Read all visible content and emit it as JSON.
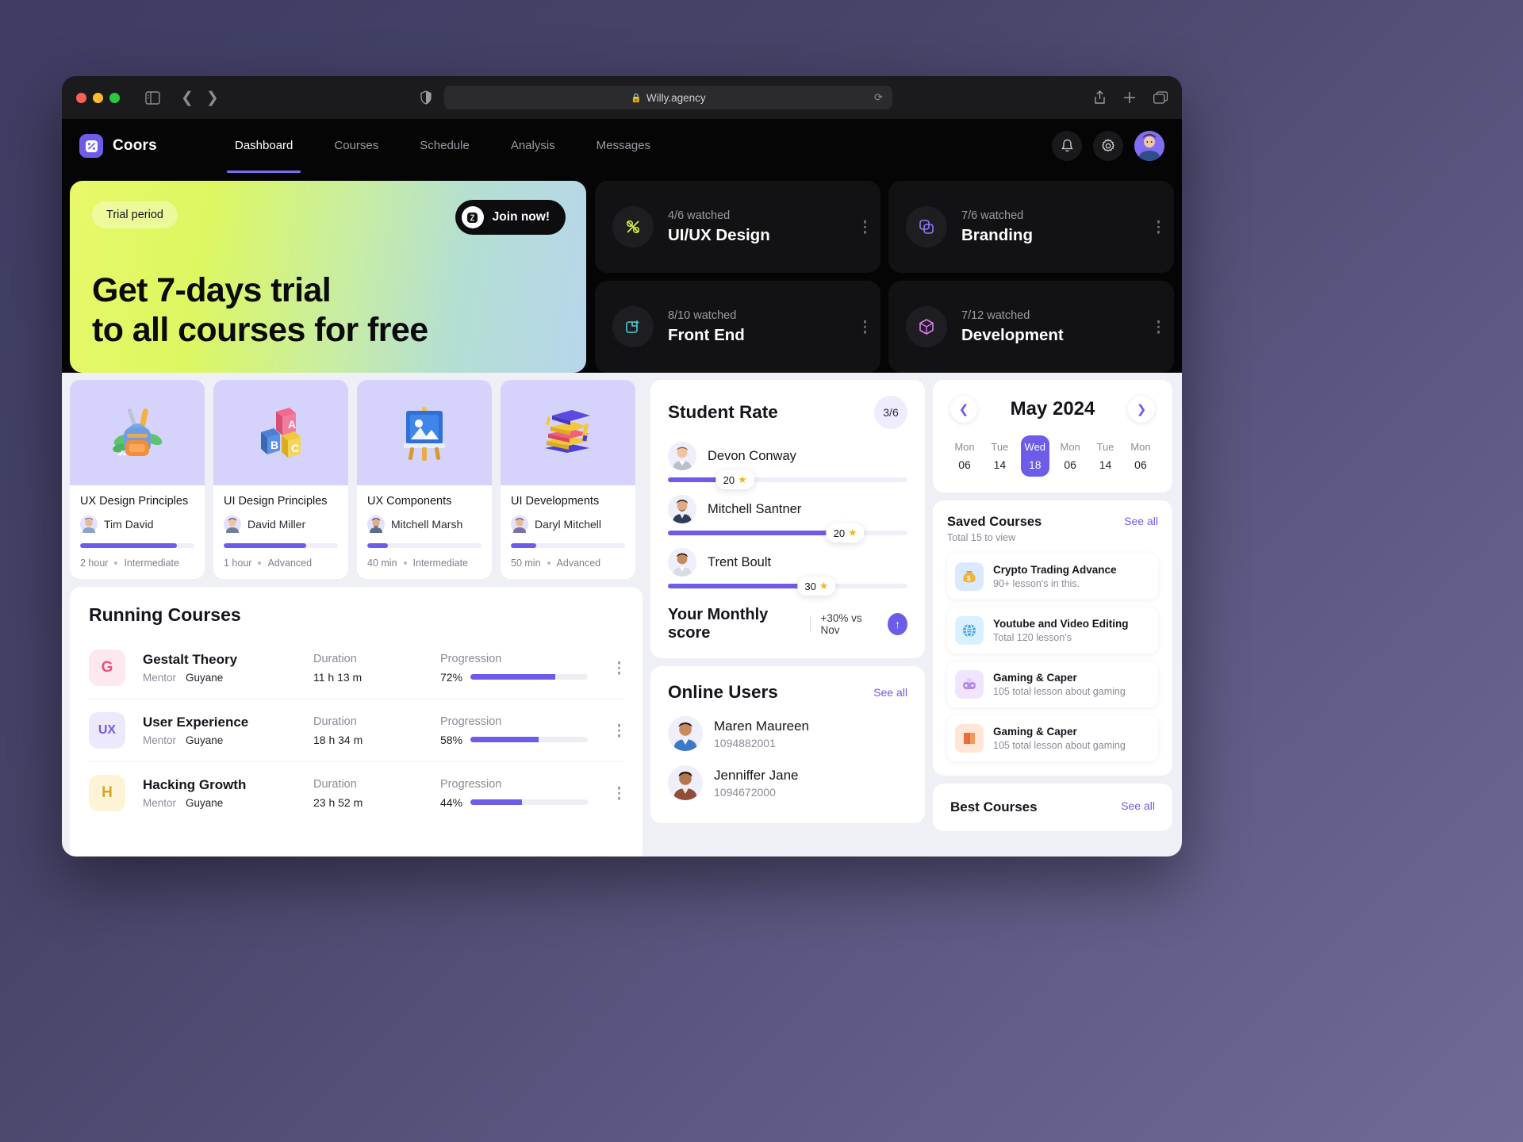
{
  "browser": {
    "url": "Willy.agency",
    "lock_icon": "lock-icon",
    "reload_icon": "reload-icon",
    "sidebar_icon": "sidebar-toggle-icon",
    "back_icon": "back-arrow-icon",
    "forward_icon": "forward-arrow-icon",
    "shield_icon": "shield-icon",
    "share_icon": "share-icon",
    "new_tab_icon": "plus-icon",
    "tabs_icon": "tabs-overview-icon"
  },
  "nav": {
    "brand": "Coors",
    "logo_icon": "coors-logo-icon",
    "tabs": [
      {
        "label": "Dashboard",
        "active": true
      },
      {
        "label": "Courses",
        "active": false
      },
      {
        "label": "Schedule",
        "active": false
      },
      {
        "label": "Analysis",
        "active": false
      },
      {
        "label": "Messages",
        "active": false
      }
    ],
    "bell_icon": "bell-icon",
    "gear_icon": "gear-icon",
    "avatar": "user-avatar"
  },
  "hero": {
    "pill": "Trial period",
    "cta": "Join now!",
    "cta_icon": "ticket-icon",
    "title_line1": "Get 7-days trial",
    "title_line2": "to all courses for free"
  },
  "stats": [
    {
      "watched": "4/6 watched",
      "title": "UI/UX Design",
      "icon": "sparkle-cross-icon",
      "color": "#d8f24b"
    },
    {
      "watched": "7/6 watched",
      "title": "Branding",
      "icon": "copy-layers-icon",
      "color": "#8e7bf5"
    },
    {
      "watched": "8/10 watched",
      "title": "Front End",
      "icon": "code-window-icon",
      "color": "#4bc8d8"
    },
    {
      "watched": "7/12 watched",
      "title": "Development",
      "icon": "cube-icon",
      "color": "#e07bf5"
    }
  ],
  "course_cards": [
    {
      "title": "UX Design Principles",
      "mentor": "Tim David",
      "avatar": "mentor-avatar",
      "progress": 85,
      "duration": "2 hour",
      "level": "Intermediate",
      "thumb": "backpack-illustration"
    },
    {
      "title": "UI Design Principles",
      "mentor": "David Miller",
      "avatar": "mentor-avatar",
      "progress": 72,
      "duration": "1 hour",
      "level": "Advanced",
      "thumb": "abc-blocks-illustration"
    },
    {
      "title": "UX Components",
      "mentor": "Mitchell Marsh",
      "avatar": "mentor-avatar",
      "progress": 18,
      "duration": "40 min",
      "level": "Intermediate",
      "thumb": "easel-illustration"
    },
    {
      "title": "UI Developments",
      "mentor": "Daryl Mitchell",
      "avatar": "mentor-avatar",
      "progress": 22,
      "duration": "50 min",
      "level": "Advanced",
      "thumb": "graduation-books-illustration"
    }
  ],
  "running": {
    "title": "Running Courses",
    "headers": {
      "duration": "Duration",
      "progression": "Progression",
      "mentor": "Mentor"
    },
    "rows": [
      {
        "initial": "G",
        "name": "Gestalt Theory",
        "mentor_label": "Mentor",
        "mentor": "Guyane",
        "duration": "11 h 13 m",
        "progress_label": "72%",
        "progress": 72,
        "bg": "#fce8ef",
        "fg": "#e8547f"
      },
      {
        "initial": "UX",
        "name": "User Experience",
        "mentor_label": "Mentor",
        "mentor": "Guyane",
        "duration": "18 h 34 m",
        "progress_label": "58%",
        "progress": 58,
        "bg": "#ece9fd",
        "fg": "#6c5ce7"
      },
      {
        "initial": "H",
        "name": "Hacking Growth",
        "mentor_label": "Mentor",
        "mentor": "Guyane",
        "duration": "23 h 52 m",
        "progress_label": "44%",
        "progress": 44,
        "bg": "#fdf3d6",
        "fg": "#d8a521"
      }
    ]
  },
  "student_rate": {
    "title": "Student Rate",
    "badge": "3/6",
    "students": [
      {
        "name": "Devon Conway",
        "score": "20",
        "fill": 22,
        "avatar": "student-avatar"
      },
      {
        "name": "Mitchell Santner",
        "score": "20",
        "fill": 68,
        "avatar": "student-avatar"
      },
      {
        "name": "Trent Boult",
        "score": "30",
        "fill": 56,
        "avatar": "student-avatar"
      }
    ],
    "monthly_label": "Your Monthly score",
    "monthly_delta": "+30% vs Nov",
    "monthly_icon": "arrow-up-icon"
  },
  "online_users": {
    "title": "Online Users",
    "see_all": "See all",
    "users": [
      {
        "name": "Maren Maureen",
        "id": "1094882001",
        "avatar": "user-avatar"
      },
      {
        "name": "Jenniffer Jane",
        "id": "1094672000",
        "avatar": "user-avatar"
      }
    ]
  },
  "calendar": {
    "month": "May 2024",
    "prev_icon": "chevron-left-icon",
    "next_icon": "chevron-right-icon",
    "days": [
      {
        "name": "Mon",
        "num": "06",
        "selected": false
      },
      {
        "name": "Tue",
        "num": "14",
        "selected": false
      },
      {
        "name": "Wed",
        "num": "18",
        "selected": true
      },
      {
        "name": "Mon",
        "num": "06",
        "selected": false
      },
      {
        "name": "Tue",
        "num": "14",
        "selected": false
      },
      {
        "name": "Mon",
        "num": "06",
        "selected": false
      }
    ]
  },
  "saved_courses": {
    "title": "Saved Courses",
    "subtitle": "Total 15 to view",
    "see_all": "See all",
    "items": [
      {
        "title": "Crypto Trading Advance",
        "sub": "90+ lesson's in this.",
        "icon": "money-bag-icon",
        "bg": "#dbe9ff"
      },
      {
        "title": "Youtube and Video Editing",
        "sub": "Total 120 lesson's",
        "icon": "globe-icon",
        "bg": "#d8f0ff"
      },
      {
        "title": "Gaming & Caper",
        "sub": "105 total lesson about gaming",
        "icon": "console-icon",
        "bg": "#f0e4ff"
      },
      {
        "title": "Gaming & Caper",
        "sub": "105 total lesson about gaming",
        "icon": "book-icon",
        "bg": "#ffe6d6"
      }
    ]
  },
  "best_courses": {
    "title": "Best Courses",
    "see_all": "See all"
  }
}
